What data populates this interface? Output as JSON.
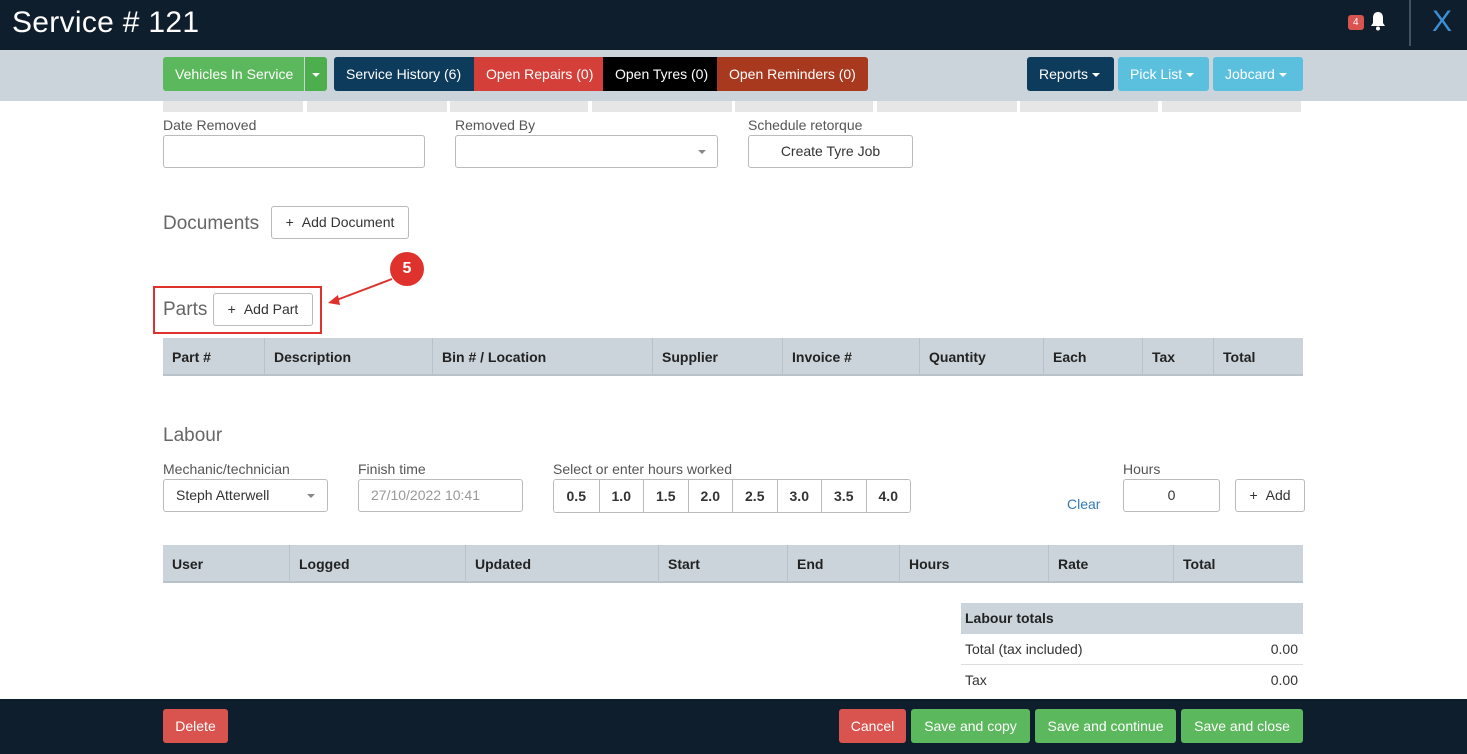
{
  "header": {
    "title": "Service # 121",
    "notification_count": "4",
    "close_label": "X"
  },
  "toolbar": {
    "vehicles_in_service": "Vehicles In Service",
    "service_history": "Service History (6)",
    "open_repairs": "Open Repairs (0)",
    "open_tyres": "Open Tyres (0)",
    "open_reminders": "Open Reminders (0)",
    "reports": "Reports",
    "pick_list": "Pick List",
    "jobcard": "Jobcard"
  },
  "tyre_fields": {
    "date_removed_label": "Date Removed",
    "date_removed_value": "",
    "removed_by_label": "Removed By",
    "removed_by_value": "",
    "schedule_retorque_label": "Schedule retorque",
    "create_tyre_job": "Create Tyre Job"
  },
  "documents": {
    "title": "Documents",
    "add_label": "Add Document"
  },
  "parts": {
    "title": "Parts",
    "add_label": "Add Part",
    "columns": [
      "Part #",
      "Description",
      "Bin # / Location",
      "Supplier",
      "Invoice #",
      "Quantity",
      "Each",
      "Tax",
      "Total"
    ]
  },
  "labour": {
    "title": "Labour",
    "mechanic_label": "Mechanic/technician",
    "mechanic_value": "Steph Atterwell",
    "finish_time_label": "Finish time",
    "finish_time_placeholder": "27/10/2022 10:41",
    "hours_worked_label": "Select or enter hours worked",
    "hour_options": [
      "0.5",
      "1.0",
      "1.5",
      "2.0",
      "2.5",
      "3.0",
      "3.5",
      "4.0"
    ],
    "clear_label": "Clear",
    "hours_label": "Hours",
    "hours_value": "0",
    "add_label": "Add",
    "columns": [
      "User",
      "Logged",
      "Updated",
      "Start",
      "End",
      "Hours",
      "Rate",
      "Total"
    ]
  },
  "labour_totals": {
    "title": "Labour totals",
    "rows": [
      {
        "label": "Total (tax included)",
        "value": "0.00"
      },
      {
        "label": "Tax",
        "value": "0.00"
      }
    ]
  },
  "footer": {
    "delete": "Delete",
    "cancel": "Cancel",
    "save_copy": "Save and copy",
    "save_continue": "Save and continue",
    "save_close": "Save and close"
  },
  "annotation": {
    "step_number": "5"
  },
  "colors": {
    "header_bg": "#0f1e2c",
    "toolbar_bg": "#cbd4db",
    "green": "#5cb85c",
    "navy": "#0d3b5c",
    "red": "#d43f3a",
    "rust": "#a8391f",
    "sky": "#5bc0de",
    "annotation_red": "#e0322c"
  }
}
